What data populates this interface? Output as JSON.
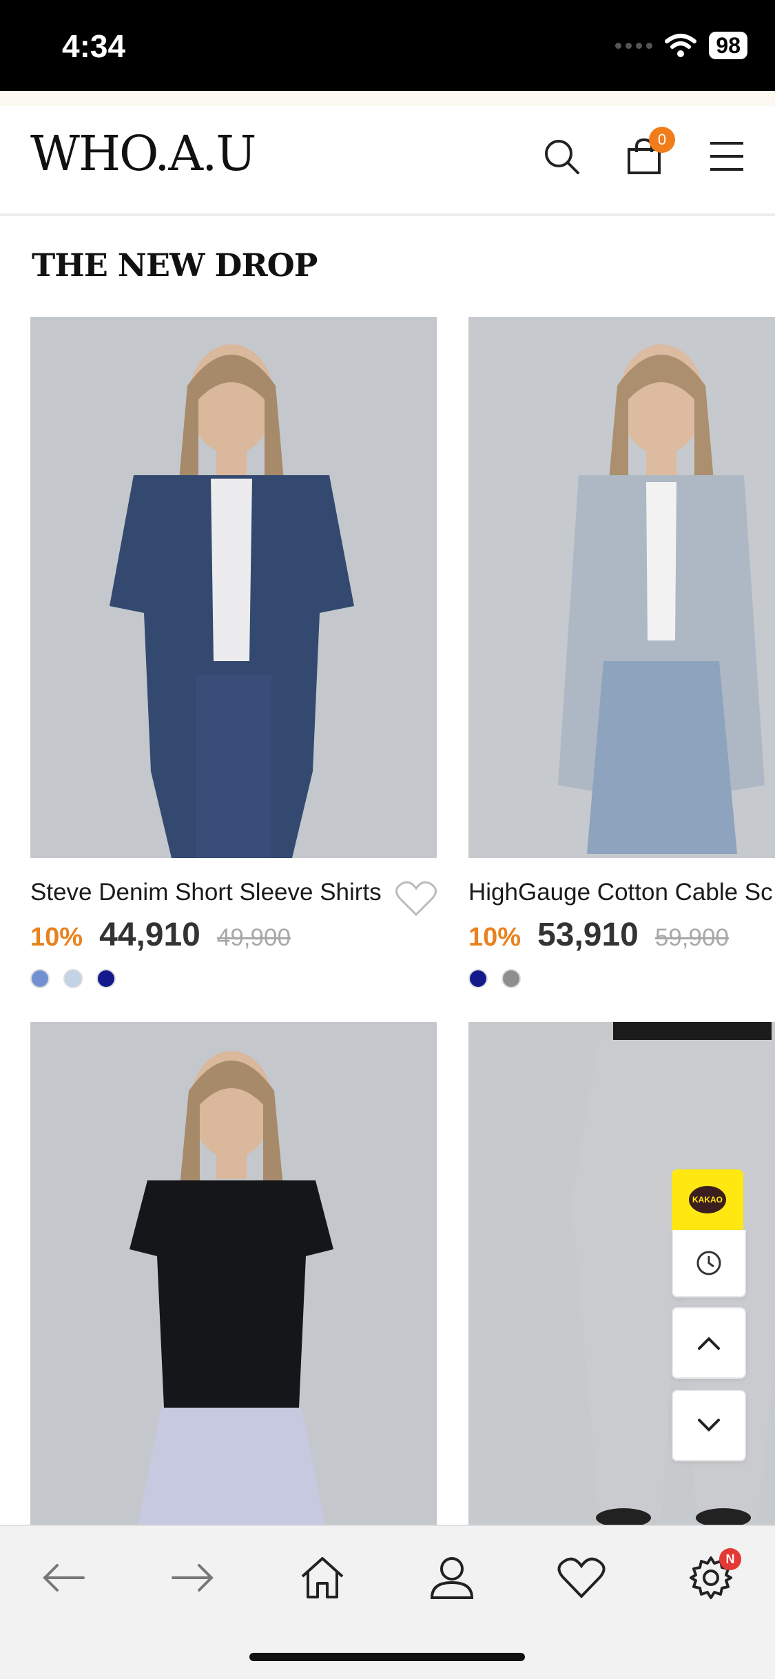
{
  "status_bar": {
    "time": "4:34",
    "battery": "98"
  },
  "header": {
    "logo": "WHO.A.U",
    "cart_count": "0"
  },
  "section": {
    "title": "THE NEW DROP"
  },
  "products": [
    {
      "name": "Steve Denim Short Sleeve Shirts",
      "discount": "10%",
      "price": "44,910",
      "original_price": "49,900",
      "swatches": [
        "#7391d2",
        "#c2d3e6",
        "#141a8c"
      ]
    },
    {
      "name": "HighGauge Cotton Cable Sc",
      "discount": "10%",
      "price": "53,910",
      "original_price": "59,900",
      "swatches": [
        "#141a8c",
        "#8e8e8e"
      ]
    }
  ],
  "floating": {
    "kakao_label": "KAKAO"
  },
  "bottom_bar": {
    "settings_badge": "N"
  },
  "colors": {
    "accent": "#f07d1a",
    "kakao": "#ffe812"
  }
}
